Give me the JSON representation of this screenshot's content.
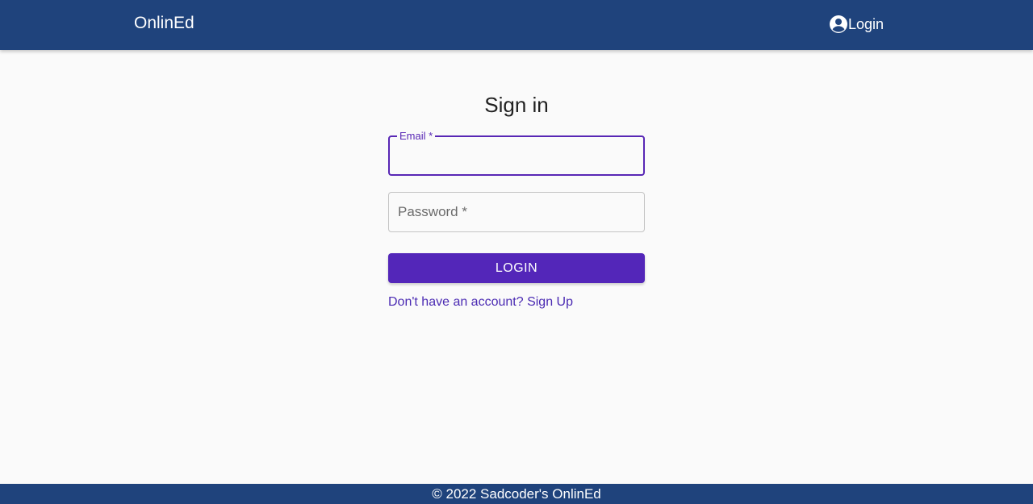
{
  "colors": {
    "appbar": "#1f437c",
    "primary": "#5326b9",
    "focus_border": "#5827b5",
    "background": "#fafafa"
  },
  "header": {
    "brand": "OnlinEd",
    "login_icon": "account-circle-icon",
    "login_label": "Login"
  },
  "form": {
    "title": "Sign in",
    "email": {
      "label": "Email *",
      "value": ""
    },
    "password": {
      "placeholder": "Password *",
      "value": ""
    },
    "submit_label": "LOGIN",
    "signup_link": "Don't have an account? Sign Up"
  },
  "footer": {
    "text": "© 2022 Sadcoder's OnlinEd"
  }
}
